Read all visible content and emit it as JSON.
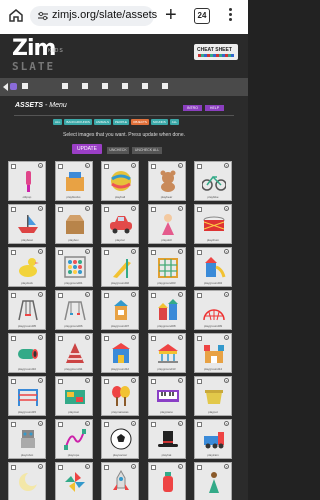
{
  "browser": {
    "url": "zimjs.org/slate/assets",
    "tab_count": "24"
  },
  "brand": {
    "name": "Zim",
    "kids": "KIDS",
    "product": "SLATE",
    "cheat_sheet": "CHEAT SHEET"
  },
  "panel": {
    "title": "ASSETS",
    "subtitle": "- Menu",
    "intro_label": "INTRO",
    "help_label": "HELP",
    "categories": [
      {
        "label": "ALL",
        "color": "#3aa8a8"
      },
      {
        "label": "BACKGROUNDS",
        "color": "#3aa8a8"
      },
      {
        "label": "ANIMALS",
        "color": "#3aa8a8"
      },
      {
        "label": "PEOPLE",
        "color": "#3aa8a8"
      },
      {
        "label": "OBJECTS",
        "color": "#e0703a"
      },
      {
        "label": "SOUNDS",
        "color": "#3aa8a8"
      },
      {
        "label": "ALL",
        "color": "#3aa8a8"
      }
    ],
    "instruction": "Select images that you want. Press update when done.",
    "update_label": "UPDATE",
    "uncheck_label": "UNCHECK",
    "uncheck_all_label": "UNCHECK ALL"
  },
  "assets": [
    {
      "label": "ollipop",
      "icon": "lollipop-icon"
    },
    {
      "label": "playblocks",
      "icon": "blocks-icon"
    },
    {
      "label": "playball",
      "icon": "ball-icon"
    },
    {
      "label": "playbear",
      "icon": "bear-icon"
    },
    {
      "label": "playbike",
      "icon": "bike-icon"
    },
    {
      "label": "playboat",
      "icon": "boat-icon"
    },
    {
      "label": "playbox",
      "icon": "box-icon"
    },
    {
      "label": "playcar",
      "icon": "car-icon"
    },
    {
      "label": "playdoll",
      "icon": "doll-icon"
    },
    {
      "label": "playdrum",
      "icon": "drum-icon"
    },
    {
      "label": "playduck",
      "icon": "duck-icon"
    },
    {
      "label": "playground01",
      "icon": "abacus-icon"
    },
    {
      "label": "playground02",
      "icon": "slide-icon"
    },
    {
      "label": "playground03",
      "icon": "climber-icon"
    },
    {
      "label": "playground04",
      "icon": "playset-icon"
    },
    {
      "label": "playground05",
      "icon": "swings-icon"
    },
    {
      "label": "playground06",
      "icon": "swing-frame-icon"
    },
    {
      "label": "playground07",
      "icon": "tower-icon"
    },
    {
      "label": "playground08",
      "icon": "gym-icon"
    },
    {
      "label": "playground09",
      "icon": "dome-icon"
    },
    {
      "label": "playground10",
      "icon": "tunnel-icon"
    },
    {
      "label": "playground11",
      "icon": "cone-icon"
    },
    {
      "label": "playground12",
      "icon": "fort-icon"
    },
    {
      "label": "playground13",
      "icon": "carousel-icon"
    },
    {
      "label": "playground14",
      "icon": "castle-icon"
    },
    {
      "label": "playground15",
      "icon": "bars-icon"
    },
    {
      "label": "playmat",
      "icon": "mat-icon"
    },
    {
      "label": "playmaracas",
      "icon": "maracas-icon"
    },
    {
      "label": "playpiano",
      "icon": "piano-icon"
    },
    {
      "label": "playpot",
      "icon": "pot-icon"
    },
    {
      "label": "playrobot",
      "icon": "robot-icon"
    },
    {
      "label": "playrope",
      "icon": "rope-icon"
    },
    {
      "label": "playsoccer",
      "icon": "soccer-ball-icon"
    },
    {
      "label": "playhat",
      "icon": "top-hat-icon"
    },
    {
      "label": "playtrain",
      "icon": "train-icon"
    },
    {
      "label": "",
      "icon": "moon-icon"
    },
    {
      "label": "",
      "icon": "pinwheel-icon"
    },
    {
      "label": "",
      "icon": "rocket-icon"
    },
    {
      "label": "",
      "icon": "bottle-icon"
    },
    {
      "label": "",
      "icon": "figure-icon"
    }
  ]
}
